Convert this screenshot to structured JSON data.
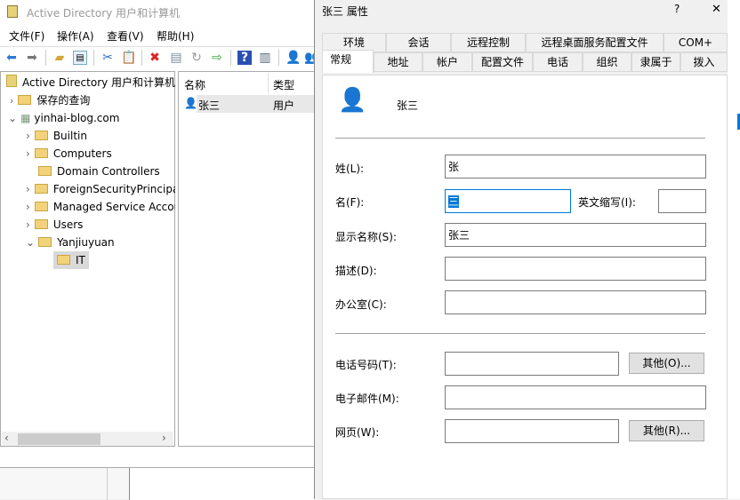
{
  "main": {
    "title": "Active Directory 用户和计算机",
    "menu": [
      "文件(F)",
      "操作(A)",
      "查看(V)",
      "帮助(H)"
    ],
    "toolbar": [
      "back-icon",
      "forward-icon",
      "up-folder-icon",
      "show-hide-console-tree-icon",
      "cut-icon",
      "paste-icon",
      "delete-icon",
      "properties-icon",
      "refresh-icon",
      "export-icon",
      "help-icon",
      "action-pane-icon",
      "new-user-icon",
      "new-group-icon"
    ],
    "tree": {
      "root": "Active Directory 用户和计算机",
      "saved": "保存的查询",
      "domain": "yinhai-blog.com",
      "items": [
        "Builtin",
        "Computers",
        "Domain Controllers",
        "ForeignSecurityPrincipals",
        "Managed Service Accounts",
        "Users",
        "Yanjiuyuan"
      ],
      "child": "IT"
    },
    "list": {
      "col_name": "名称",
      "col_type": "类型",
      "rows": [
        {
          "name": "张三",
          "type": "用户"
        }
      ]
    }
  },
  "dialog": {
    "title": "张三 属性",
    "help": "?",
    "close": "✕",
    "tabs_top": [
      "环境",
      "会话",
      "远程控制",
      "远程桌面服务配置文件",
      "COM+"
    ],
    "tabs_bottom": [
      "常规",
      "地址",
      "帐户",
      "配置文件",
      "电话",
      "组织",
      "隶属于",
      "拨入"
    ],
    "user_name": "张三",
    "fields": {
      "last_label": "姓(L):",
      "last": "张",
      "first_label": "名(F):",
      "first": "三",
      "initials_label": "英文缩写(I):",
      "initials": "",
      "display_label": "显示名称(S):",
      "display": "张三",
      "desc_label": "描述(D):",
      "desc": "",
      "office_label": "办公室(C):",
      "office": "",
      "phone_label": "电话号码(T):",
      "phone": "",
      "phone_other": "其他(O)...",
      "email_label": "电子邮件(M):",
      "email": "",
      "web_label": "网页(W):",
      "web": "",
      "web_other": "其他(R)..."
    }
  },
  "colors": {
    "selection": "#0078d7",
    "focus_border": "#0078d7"
  }
}
